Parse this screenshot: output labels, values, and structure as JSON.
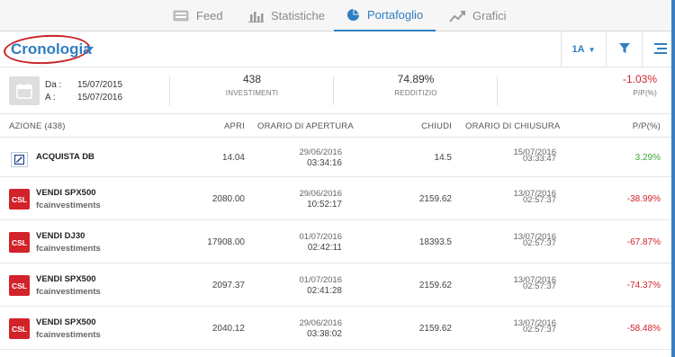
{
  "nav": {
    "tabs": [
      {
        "label": "Feed",
        "icon": "feed-icon"
      },
      {
        "label": "Statistiche",
        "icon": "bar-chart-icon"
      },
      {
        "label": "Portafoglio",
        "icon": "pie-chart-icon"
      },
      {
        "label": "Grafici",
        "icon": "line-chart-icon"
      }
    ],
    "active": "Portafoglio"
  },
  "header": {
    "title": "Cronologia",
    "period_label": "1A"
  },
  "summary": {
    "from_label": "Da :",
    "from_date": "15/07/2015",
    "to_label": "A :",
    "to_date": "15/07/2016",
    "investments_value": "438",
    "investments_label": "INVESTIMENTI",
    "yield_value": "74.89%",
    "yield_label": "REDDITIZIO",
    "pl_value": "-1.03%",
    "pl_label": "P/P(%)"
  },
  "table": {
    "headers": {
      "azione": "AZIONE (438)",
      "apri": "APRI",
      "orario_apertura": "ORARIO DI APERTURA",
      "chiudi": "CHIUDI",
      "orario_chiusura": "ORARIO DI CHIUSURA",
      "pp": "P/P(%)"
    },
    "rows": [
      {
        "logo": "DB",
        "name": "ACQUISTA DB",
        "user": "",
        "open": "14.04",
        "open_date": "29/06/2016",
        "open_time": "03:34:16",
        "close": "14.5",
        "close_date": "15/07/2016",
        "close_time": "03:33:47",
        "pp": "3.29%",
        "pp_sign": "pos"
      },
      {
        "logo": "CSL",
        "name": "VENDI SPX500",
        "user": "fcainvestiments",
        "open": "2080.00",
        "open_date": "29/06/2016",
        "open_time": "10:52:17",
        "close": "2159.62",
        "close_date": "13/07/2016",
        "close_time": "02:57:37",
        "pp": "-38.99%",
        "pp_sign": "neg"
      },
      {
        "logo": "CSL",
        "name": "VENDI DJ30",
        "user": "fcainvestiments",
        "open": "17908.00",
        "open_date": "01/07/2016",
        "open_time": "02:42:11",
        "close": "18393.5",
        "close_date": "13/07/2016",
        "close_time": "02:57:37",
        "pp": "-67.87%",
        "pp_sign": "neg"
      },
      {
        "logo": "CSL",
        "name": "VENDI SPX500",
        "user": "fcainvestiments",
        "open": "2097.37",
        "open_date": "01/07/2016",
        "open_time": "02:41:28",
        "close": "2159.62",
        "close_date": "13/07/2016",
        "close_time": "02:57:37",
        "pp": "-74.37%",
        "pp_sign": "neg"
      },
      {
        "logo": "CSL",
        "name": "VENDI SPX500",
        "user": "fcainvestiments",
        "open": "2040.12",
        "open_date": "29/06/2016",
        "open_time": "03:38:02",
        "close": "2159.62",
        "close_date": "13/07/2016",
        "close_time": "02:57:37",
        "pp": "-58.48%",
        "pp_sign": "neg"
      }
    ]
  },
  "colors": {
    "accent": "#2f7fc2",
    "positive": "#3ca63c",
    "negative": "#d0232b",
    "highlight_ring": "#c8232b"
  }
}
